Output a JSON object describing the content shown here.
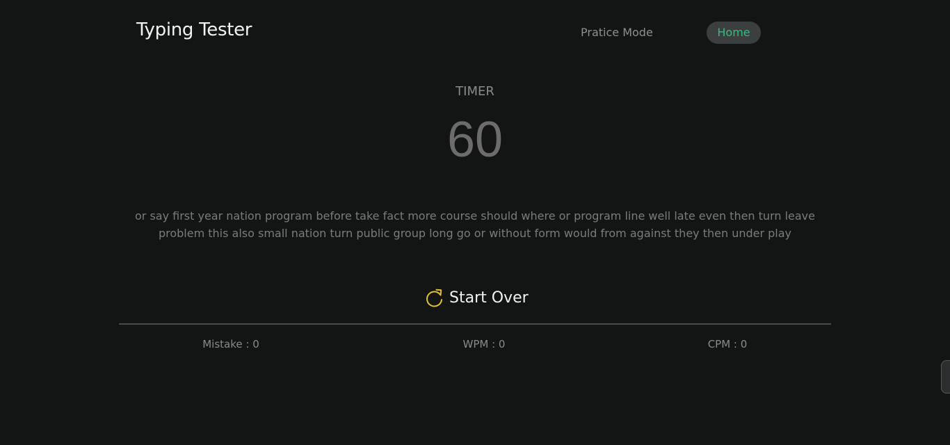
{
  "header": {
    "brand": "Typing Tester",
    "nav": {
      "practice_label": "Pratice Mode",
      "home_label": "Home"
    }
  },
  "timer": {
    "label": "TIMER",
    "value": "60"
  },
  "passage": {
    "text": "or say first year nation program before take fact more course should where or program line well late even then turn leave problem this also small nation turn public group long go or without form would from against they then under play"
  },
  "controls": {
    "start_over_label": "Start Over"
  },
  "stats": {
    "mistake": "Mistake : 0",
    "wpm": "WPM : 0",
    "cpm": "CPM : 0"
  },
  "colors": {
    "background": "#131515",
    "accent_green": "#2fbf82",
    "accent_yellow": "#e2c233"
  },
  "icons": {
    "restart": "restart-icon"
  }
}
